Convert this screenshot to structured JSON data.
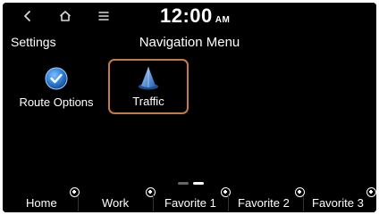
{
  "statusbar": {
    "back_icon": "back-chevron-icon",
    "home_icon": "home-icon",
    "menu_icon": "hamburger-menu-icon",
    "time": "12:00",
    "ampm": "AM"
  },
  "titlebar": {
    "settings_label": "Settings",
    "title": "Navigation Menu"
  },
  "menu": {
    "items": [
      {
        "label": "Route Options",
        "icon": "route-options-icon",
        "selected": false
      },
      {
        "label": "Traffic",
        "icon": "traffic-icon",
        "selected": true
      }
    ]
  },
  "pager": {
    "pages": 2,
    "current": 2
  },
  "favorites": [
    {
      "label": "Home",
      "icon": "add-icon"
    },
    {
      "label": "Work",
      "icon": "add-icon"
    },
    {
      "label": "Favorite 1",
      "icon": "add-icon"
    },
    {
      "label": "Favorite 2",
      "icon": "add-icon"
    },
    {
      "label": "Favorite 3",
      "icon": "add-icon"
    }
  ],
  "colors": {
    "selection_border": "#c47b3d",
    "route_icon_blue": "#2e7fd6",
    "traffic_icon_blue": "#3b78c9"
  }
}
